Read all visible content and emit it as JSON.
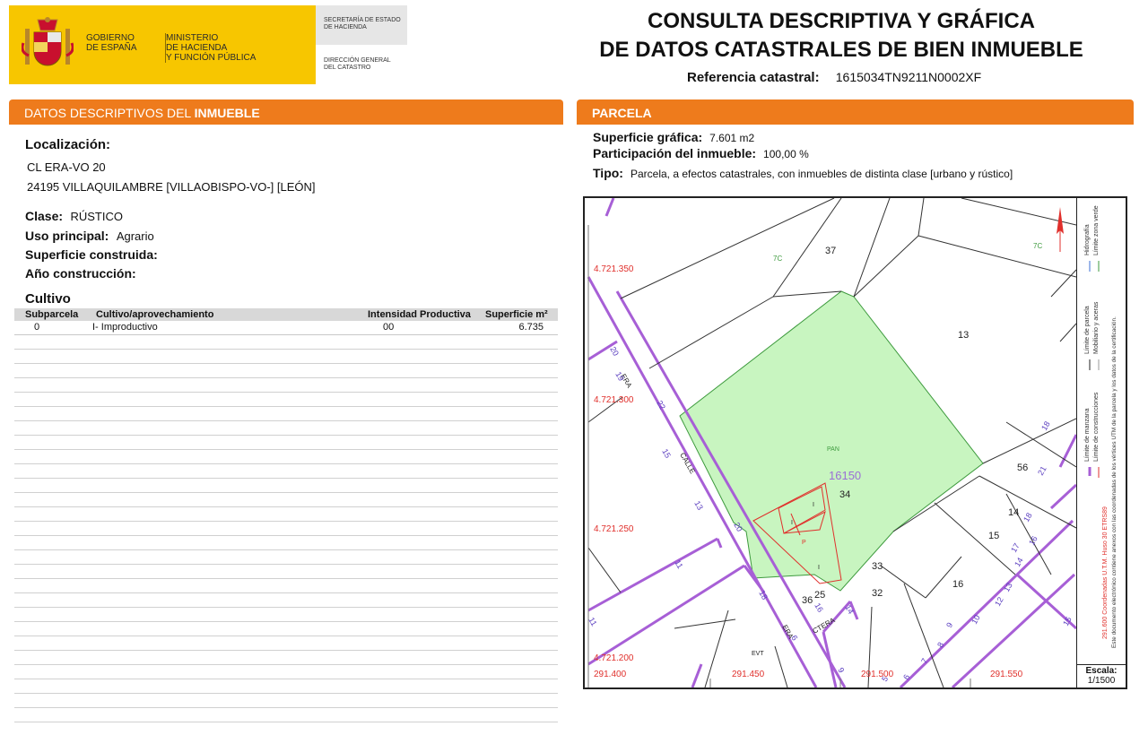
{
  "header": {
    "gov": [
      "GOBIERNO",
      "DE ESPAÑA"
    ],
    "ministry": [
      "MINISTERIO",
      "DE HACIENDA",
      "Y FUNCIÓN PÚBLICA"
    ],
    "secretaria": [
      "SECRETARÍA DE ESTADO",
      "DE HACIENDA"
    ],
    "direccion": [
      "DIRECCIÓN GENERAL",
      "DEL CATASTRO"
    ],
    "title_line1": "CONSULTA DESCRIPTIVA Y GRÁFICA",
    "title_line2": "DE DATOS CATASTRALES DE BIEN INMUEBLE",
    "ref_label": "Referencia catastral:",
    "ref_value": "1615034TN9211N0002XF"
  },
  "left": {
    "banner": "DATOS DESCRIPTIVOS DEL ",
    "banner_bold": "INMUEBLE",
    "localizacion_label": "Localización:",
    "address1": "CL ERA-VO 20",
    "address2": "24195 VILLAQUILAMBRE [VILLAOBISPO-VO-] [LEÓN]",
    "clase_label": "Clase:",
    "clase_value": "RÚSTICO",
    "uso_label": "Uso principal:",
    "uso_value": "Agrario",
    "superficie_label": "Superficie construida:",
    "anio_label": "Año construcción:",
    "cultivo_title": "Cultivo",
    "table_headers": {
      "subparcela": "Subparcela",
      "cultivo": "Cultivo/aprovechamiento",
      "intensidad": "Intensidad Productiva",
      "superficie": "Superficie m²"
    },
    "rows": [
      {
        "subparcela": "0",
        "cultivo": "I- Improductivo",
        "intensidad": "00",
        "superficie": "6.735"
      }
    ]
  },
  "right": {
    "banner": "PARCELA",
    "superficie_grafica_label": "Superficie gráfica:",
    "superficie_grafica_value": "7.601 m2",
    "participacion_label": "Participación del inmueble:",
    "participacion_value": "100,00 %",
    "tipo_label": "Tipo:",
    "tipo_value": "Parcela, a efectos catastrales, con inmuebles de distinta clase [urbano y rústico]"
  },
  "map": {
    "y_coords": [
      "4.721.350",
      "4.721.300",
      "4.721.250",
      "4.721.200"
    ],
    "x_coords": [
      "291.400",
      "291.450",
      "291.500",
      "291.550"
    ],
    "parcel_labels": [
      "37",
      "13",
      "56",
      "14",
      "15",
      "16",
      "33",
      "32",
      "34",
      "36",
      "25"
    ],
    "parcel_id": "16150",
    "street_labels": [
      "ERA",
      "CALLE",
      "ERA",
      "CTERA"
    ],
    "street_numbers": [
      "20",
      "19",
      "22",
      "15",
      "13",
      "20",
      "11",
      "11",
      "18",
      "16",
      "14",
      "9",
      "21",
      "16",
      "18",
      "17",
      "14",
      "13",
      "12",
      "10",
      "9",
      "8",
      "7",
      "6",
      "5",
      "6",
      "18",
      "15"
    ],
    "small_labels": [
      "7C",
      "7C",
      "PAN",
      "EVT",
      "I",
      "I",
      "I",
      "P"
    ],
    "legend": [
      "Límite de manzana",
      "Límite de parcela",
      "Hidrografía",
      "Límite de construcciones",
      "Mobiliario y aceras",
      "Límite zona verde"
    ],
    "coord_note": "291.600 Coordenadas U.T.M. Huso 30 ETRS89",
    "doc_note": "Este documento electrónico contiene anexos con las coordenadas de los vértices UTM de la parcela y los datos de la certificación.",
    "scale_label": "Escala:",
    "scale_value": "1/1500"
  },
  "colors": {
    "banner": "#ee7b1c",
    "gov_yellow": "#f7c600",
    "parcel_fill": "#c8f5c0",
    "block_line": "#a75fd6",
    "coord_red": "#e0302c"
  }
}
